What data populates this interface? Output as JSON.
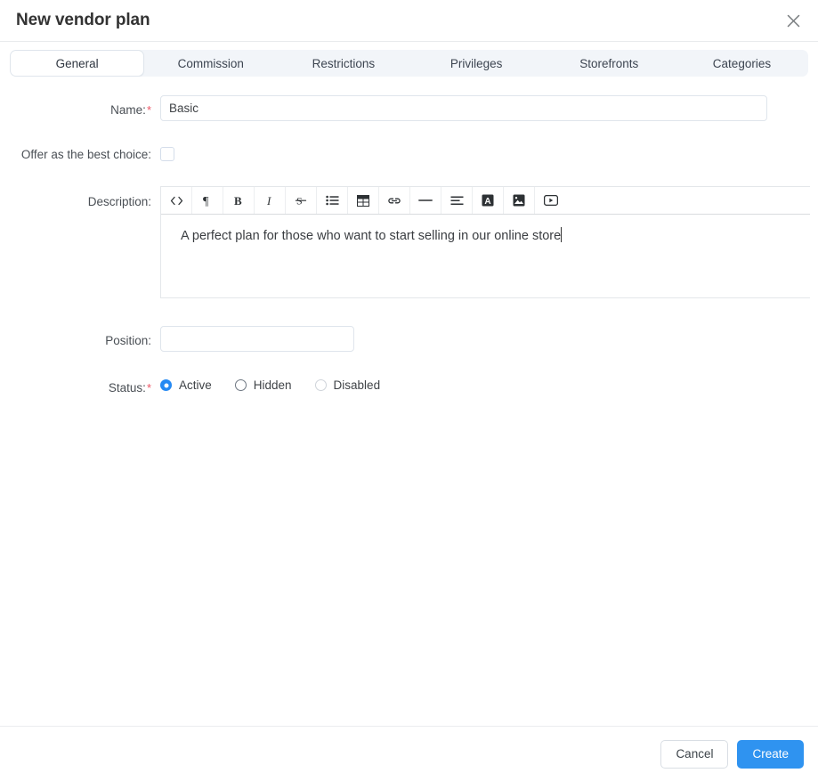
{
  "modal": {
    "title": "New vendor plan",
    "close_icon": "close-icon"
  },
  "tabs": [
    {
      "label": "General",
      "active": true
    },
    {
      "label": "Commission",
      "active": false
    },
    {
      "label": "Restrictions",
      "active": false
    },
    {
      "label": "Privileges",
      "active": false
    },
    {
      "label": "Storefronts",
      "active": false
    },
    {
      "label": "Categories",
      "active": false
    }
  ],
  "form": {
    "name": {
      "label": "Name:",
      "required_marker": "*",
      "value": "Basic",
      "placeholder": ""
    },
    "best_choice": {
      "label": "Offer as the best choice:",
      "checked": false
    },
    "description": {
      "label": "Description:",
      "value": "A perfect plan for those who want to start selling in our online store",
      "toolbar": [
        {
          "name": "source-code-icon",
          "title": "<>"
        },
        {
          "name": "paragraph-icon",
          "title": "¶"
        },
        {
          "name": "bold-icon",
          "title": "B"
        },
        {
          "name": "italic-icon",
          "title": "I"
        },
        {
          "name": "strikethrough-icon",
          "title": "S"
        },
        {
          "name": "bullet-list-icon",
          "title": "List"
        },
        {
          "name": "table-icon",
          "title": "Table"
        },
        {
          "name": "link-icon",
          "title": "Link"
        },
        {
          "name": "horizontal-rule-icon",
          "title": "HR"
        },
        {
          "name": "align-icon",
          "title": "Align"
        },
        {
          "name": "text-color-icon",
          "title": "A"
        },
        {
          "name": "image-icon",
          "title": "Image"
        },
        {
          "name": "video-icon",
          "title": "Video"
        }
      ]
    },
    "position": {
      "label": "Position:",
      "value": "",
      "placeholder": ""
    },
    "status": {
      "label": "Status:",
      "required_marker": "*",
      "options": [
        {
          "label": "Active",
          "selected": true,
          "disabled": false
        },
        {
          "label": "Hidden",
          "selected": false,
          "disabled": false
        },
        {
          "label": "Disabled",
          "selected": false,
          "disabled": true
        }
      ]
    }
  },
  "footer": {
    "cancel_label": "Cancel",
    "create_label": "Create"
  },
  "colors": {
    "accent": "#2f93f0",
    "radio_selected": "#2589f3",
    "required": "#ed5565",
    "tabbar_bg": "#f2f5f9",
    "border": "#dfe5ec"
  }
}
